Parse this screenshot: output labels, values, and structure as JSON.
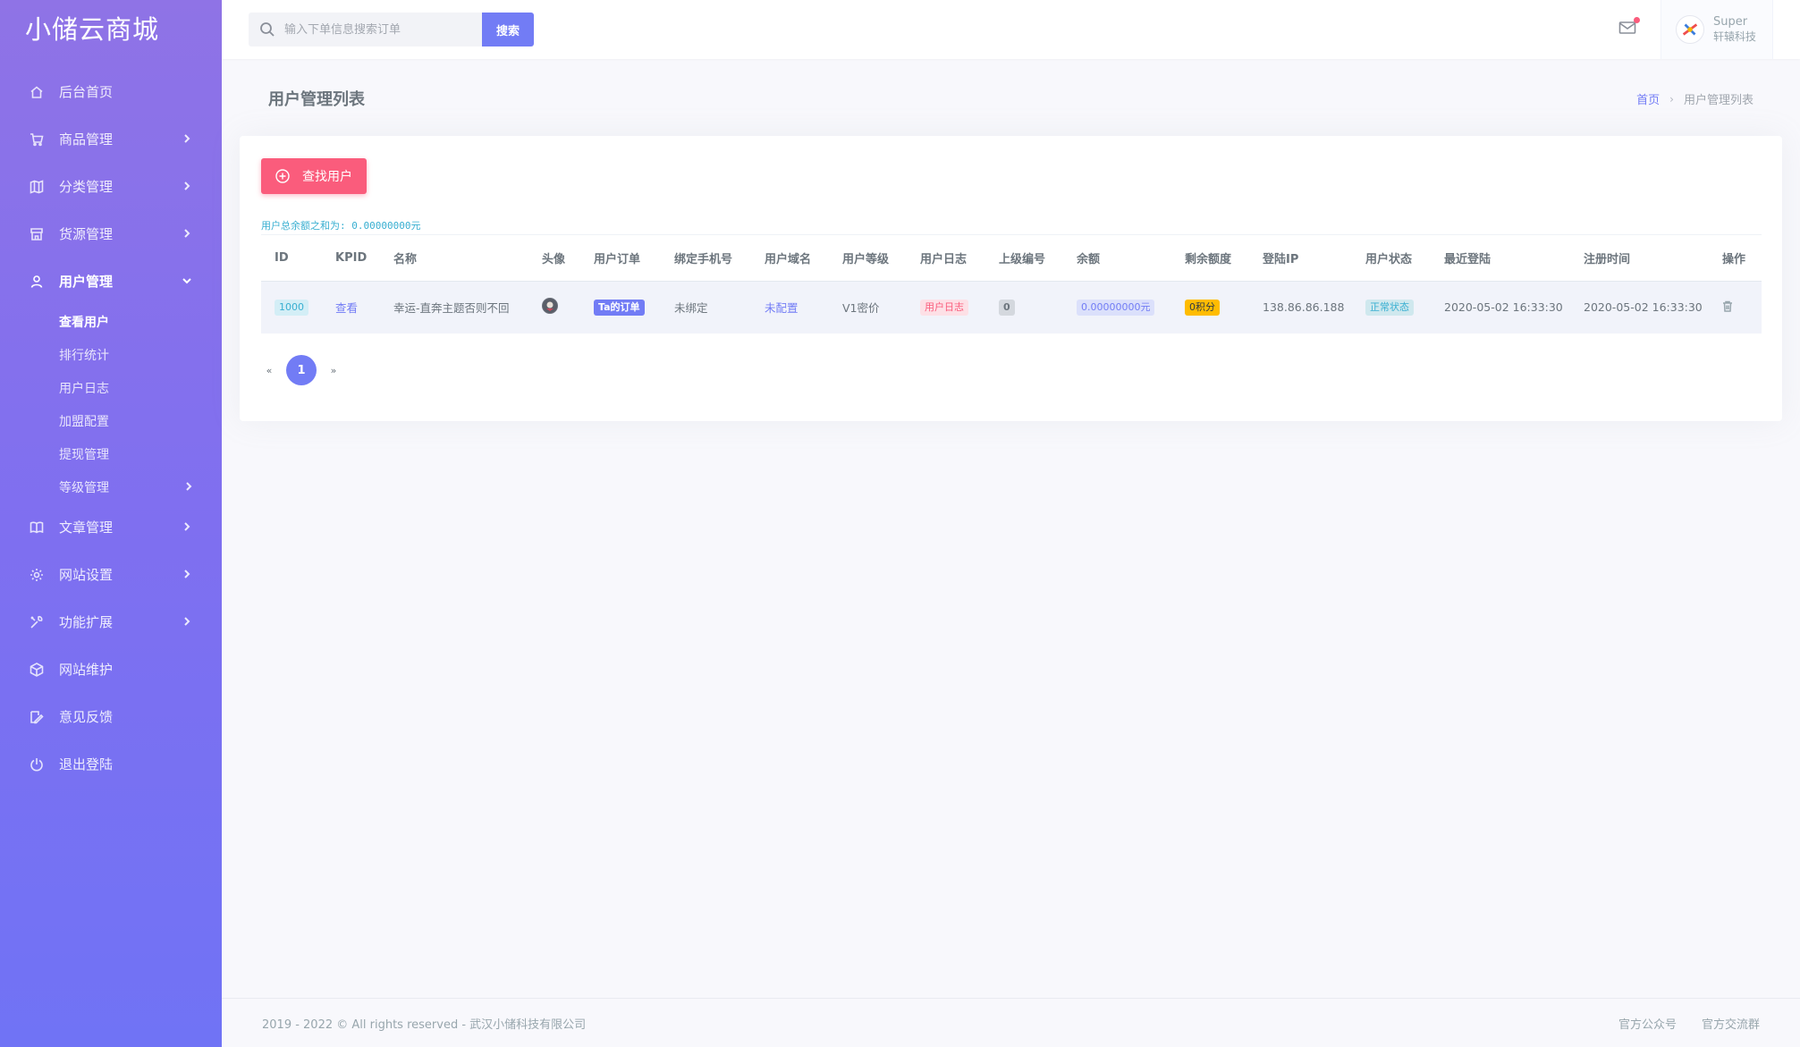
{
  "brand": "小储云商城",
  "sidebar": {
    "items": [
      {
        "label": "后台首页"
      },
      {
        "label": "商品管理"
      },
      {
        "label": "分类管理"
      },
      {
        "label": "货源管理"
      },
      {
        "label": "用户管理"
      },
      {
        "label": "文章管理"
      },
      {
        "label": "网站设置"
      },
      {
        "label": "功能扩展"
      },
      {
        "label": "网站维护"
      },
      {
        "label": "意见反馈"
      },
      {
        "label": "退出登陆"
      }
    ],
    "sub_items": [
      {
        "label": "查看用户"
      },
      {
        "label": "排行统计"
      },
      {
        "label": "用户日志"
      },
      {
        "label": "加盟配置"
      },
      {
        "label": "提现管理"
      },
      {
        "label": "等级管理"
      }
    ]
  },
  "topbar": {
    "search_placeholder": "输入下单信息搜索订单",
    "search_button": "搜索",
    "user_name": "Super",
    "user_sub": "轩辕科技"
  },
  "page": {
    "title": "用户管理列表",
    "breadcrumb_home": "首页",
    "breadcrumb_sep": "›",
    "breadcrumb_current": "用户管理列表"
  },
  "card": {
    "find_button": "查找用户",
    "total_text": "用户总余额之和为: 0.00000000元"
  },
  "table": {
    "headers": [
      "ID",
      "KPID",
      "名称",
      "头像",
      "用户订单",
      "绑定手机号",
      "用户域名",
      "用户等级",
      "用户日志",
      "上级编号",
      "余额",
      "剩余额度",
      "登陆IP",
      "用户状态",
      "最近登陆",
      "注册时间",
      "操作"
    ],
    "row": {
      "id": "1000",
      "kpid": "查看",
      "name": "幸运-直奔主题否则不回",
      "orders": "Ta的订单",
      "phone": "未绑定",
      "domain": "未配置",
      "level": "V1密价",
      "log": "用户日志",
      "parent": "0",
      "balance": "0.00000000元",
      "quota": "0积分",
      "ip": "138.86.86.188",
      "status": "正常状态",
      "last_login": "2020-05-02 16:33:30",
      "register": "2020-05-02 16:33:30"
    }
  },
  "pagination": {
    "prev": "«",
    "current": "1",
    "next": "»"
  },
  "footer": {
    "copyright": "2019 - 2022 © All rights reserved - 武汉小储科技有限公司",
    "link1": "官方公众号",
    "link2": "官方交流群"
  }
}
